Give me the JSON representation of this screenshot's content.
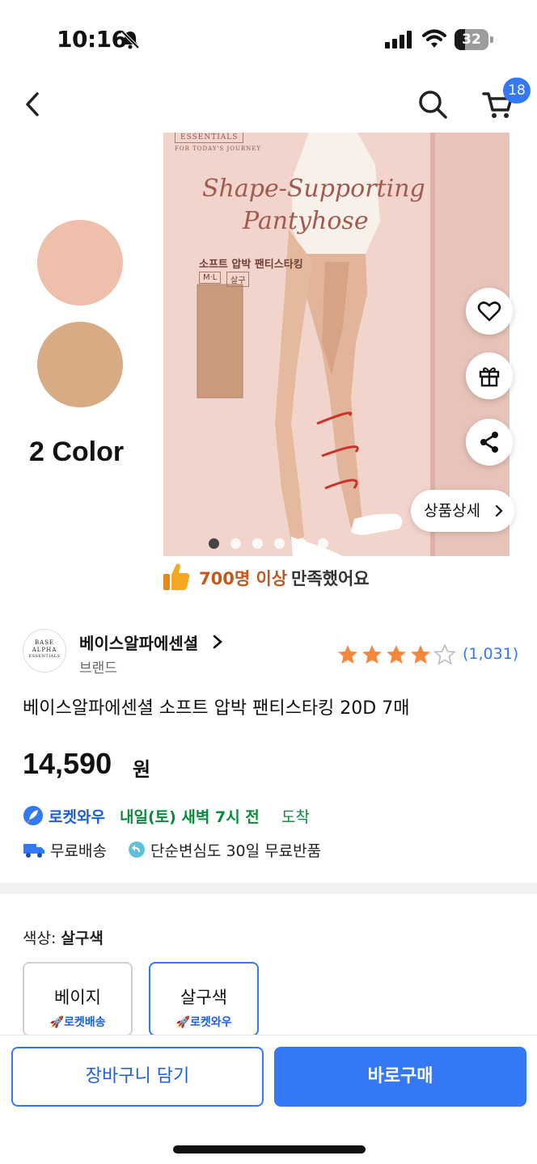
{
  "status_bar": {
    "time": "10:16",
    "battery_level": "32",
    "battery_fraction": 0.32,
    "icons": [
      "bell-slash-icon",
      "signal-icon",
      "wifi-icon",
      "battery-icon"
    ]
  },
  "nav": {
    "icons": [
      "chevron-left-icon",
      "search-icon",
      "cart-icon"
    ],
    "cart_count": "18"
  },
  "hero": {
    "color_count_label": "2 Color",
    "swatch_colors": [
      "#eebfaa",
      "#d7ab83"
    ],
    "package": {
      "brand_line": "ESSENTIALS",
      "sub_line": "FOR TODAY'S JOURNEY",
      "script_line_1": "Shape-Supporting",
      "script_line_2": "Pantyhose",
      "korean_line": "소프트 압박 팬티스타킹",
      "size": "M·L",
      "shade": "살구"
    },
    "image_count": 6,
    "active_image_index": 0,
    "detail_button_label": "상품상세",
    "side_icons": [
      "heart-icon",
      "gift-icon",
      "share-icon"
    ]
  },
  "satisfaction": {
    "highlight": "700명 이상",
    "rest": "만족했어요"
  },
  "brand": {
    "logo_lines": [
      "BASE",
      "ALPHA",
      "ESSENTIALS"
    ],
    "name": "베이스알파에센셜",
    "sub_label": "브랜드",
    "rating": 4,
    "rating_max": 5,
    "review_count": "(1,031)"
  },
  "product": {
    "title": "베이스알파에센셜 소프트 압박 팬티스타킹 20D 7매",
    "price": "14,590",
    "price_unit": "원"
  },
  "delivery": {
    "rocket_label": "로켓와우",
    "date_text": "내일(토) 새벽 7시 전",
    "suffix": "도착",
    "shipping_label": "무료배송",
    "return_label": "단순변심도 30일 무료반품"
  },
  "options": {
    "label_prefix": "색상: ",
    "selected_value": "살구색",
    "cards": [
      {
        "name": "베이지",
        "tag": "로켓배송",
        "selected": false
      },
      {
        "name": "살구색",
        "tag": "로켓와우",
        "selected": true
      }
    ]
  },
  "actions": {
    "cart_button": "장바구니 담기",
    "buy_button": "바로구매"
  },
  "colors": {
    "accent": "#3478f6",
    "rating_star": "#f5873a",
    "delivery_green": "#0b8a3c",
    "satisfaction_orange": "#c5561c"
  }
}
